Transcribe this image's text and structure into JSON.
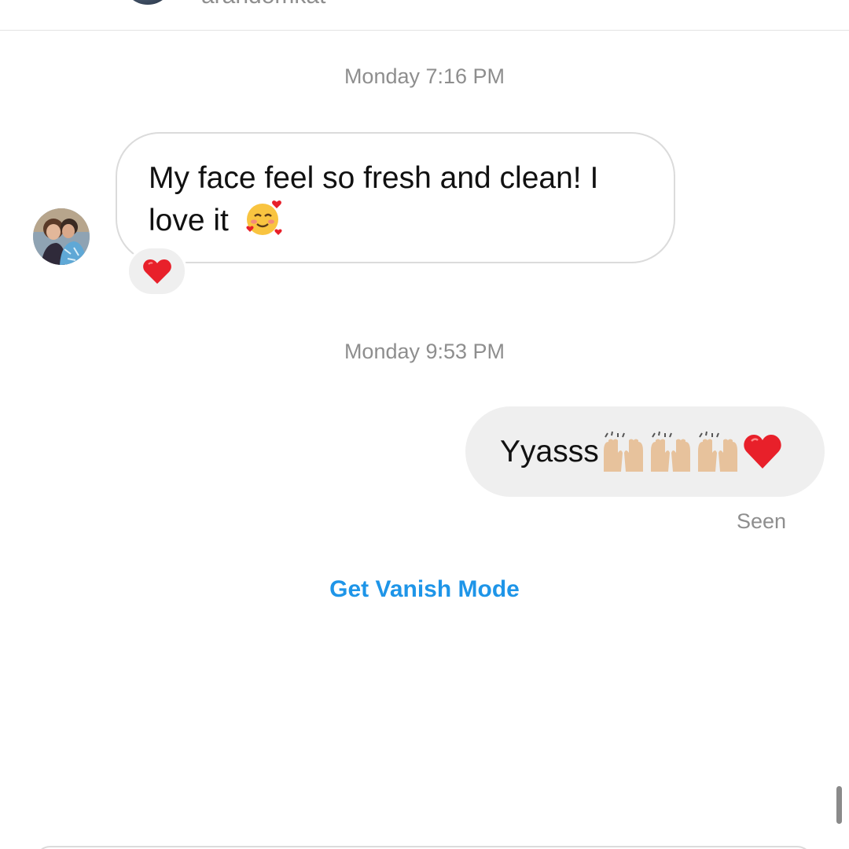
{
  "header": {
    "username": "arandomkat"
  },
  "conversation": {
    "timestamps": [
      "Monday 7:16 PM",
      "Monday 9:53 PM"
    ],
    "incoming": {
      "line1": "My face feel so fresh and clean! I",
      "line2": "love it",
      "emoji_icon": "smiling-face-with-hearts-icon",
      "reaction_icon": "red-heart-icon"
    },
    "outgoing": {
      "text": "Yyasss",
      "emoji_icons": [
        "raising-hands-icon",
        "raising-hands-icon",
        "raising-hands-icon",
        "red-heart-icon"
      ],
      "status": "Seen"
    },
    "vanish_mode_label": "Get Vanish Mode"
  },
  "colors": {
    "link_blue": "#1e95e8",
    "meta_gray": "#8e8e8e",
    "bubble_gray": "#efefef",
    "heart_red": "#e8202a"
  }
}
